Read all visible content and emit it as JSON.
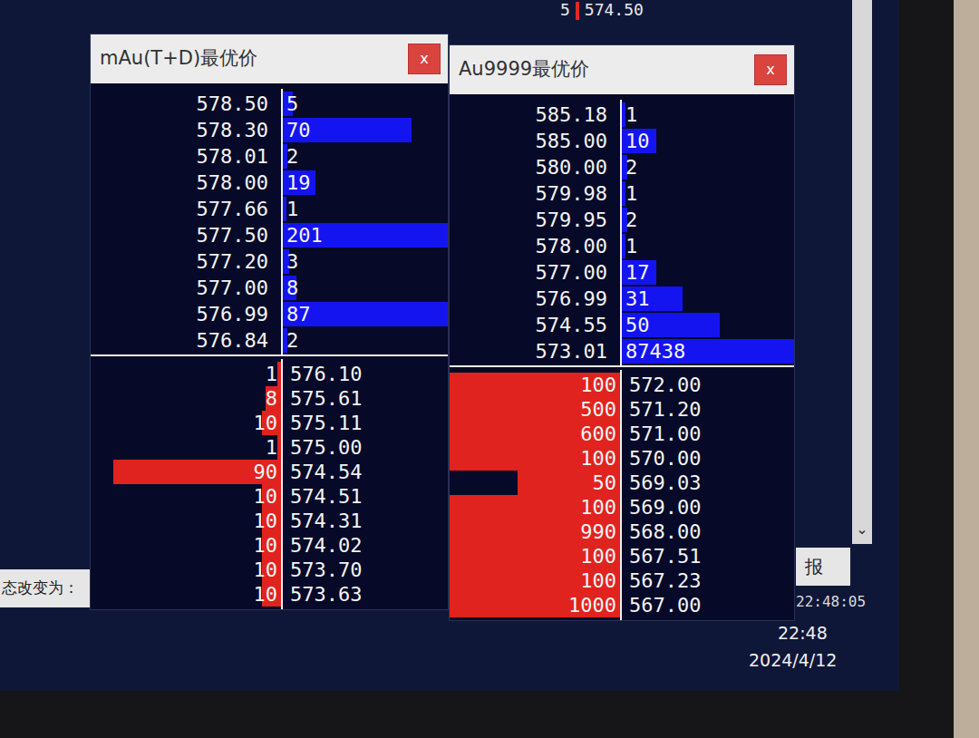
{
  "top_fragment": {
    "prefix": "5",
    "price": "574.50"
  },
  "windows": [
    {
      "title": "mAu(T+D)最优价",
      "close": "x",
      "asks": [
        {
          "price": "578.50",
          "qty": "5",
          "level": 0.06
        },
        {
          "price": "578.30",
          "qty": "70",
          "level": 0.78
        },
        {
          "price": "578.01",
          "qty": "2",
          "level": 0.03
        },
        {
          "price": "578.00",
          "qty": "19",
          "level": 0.2
        },
        {
          "price": "577.66",
          "qty": "1",
          "level": 0.02
        },
        {
          "price": "577.50",
          "qty": "201",
          "level": 1
        },
        {
          "price": "577.20",
          "qty": "3",
          "level": 0.04
        },
        {
          "price": "577.00",
          "qty": "8",
          "level": 0.08
        },
        {
          "price": "576.99",
          "qty": "87",
          "level": 1
        },
        {
          "price": "576.84",
          "qty": "2",
          "level": 0.03
        }
      ],
      "bids": [
        {
          "qty": "1",
          "price": "576.10",
          "level": 0.02
        },
        {
          "qty": "8",
          "price": "575.61",
          "level": 0.08
        },
        {
          "qty": "10",
          "price": "575.11",
          "level": 0.1
        },
        {
          "qty": "1",
          "price": "575.00",
          "level": 0.02
        },
        {
          "qty": "90",
          "price": "574.54",
          "level": 0.88
        },
        {
          "qty": "10",
          "price": "574.51",
          "level": 0.1
        },
        {
          "qty": "10",
          "price": "574.31",
          "level": 0.1
        },
        {
          "qty": "10",
          "price": "574.02",
          "level": 0.1
        },
        {
          "qty": "10",
          "price": "573.70",
          "level": 0.1
        },
        {
          "qty": "10",
          "price": "573.63",
          "level": 0.1
        }
      ]
    },
    {
      "title": "Au9999最优价",
      "close": "x",
      "asks": [
        {
          "price": "585.18",
          "qty": "1",
          "level": 0.02
        },
        {
          "price": "585.00",
          "qty": "10",
          "level": 0.2
        },
        {
          "price": "580.00",
          "qty": "2",
          "level": 0.03
        },
        {
          "price": "579.98",
          "qty": "1",
          "level": 0.02
        },
        {
          "price": "579.95",
          "qty": "2",
          "level": 0.03
        },
        {
          "price": "578.00",
          "qty": "1",
          "level": 0.02
        },
        {
          "price": "577.00",
          "qty": "17",
          "level": 0.2
        },
        {
          "price": "576.99",
          "qty": "31",
          "level": 0.35
        },
        {
          "price": "574.55",
          "qty": "50",
          "level": 0.57
        },
        {
          "price": "573.01",
          "qty": "87438",
          "level": 1
        }
      ],
      "bids": [
        {
          "qty": "100",
          "price": "572.00",
          "level": 1
        },
        {
          "qty": "500",
          "price": "571.20",
          "level": 1
        },
        {
          "qty": "600",
          "price": "571.00",
          "level": 1
        },
        {
          "qty": "100",
          "price": "570.00",
          "level": 1
        },
        {
          "qty": "50",
          "price": "569.03",
          "level": 0.6
        },
        {
          "qty": "100",
          "price": "569.00",
          "level": 1
        },
        {
          "qty": "990",
          "price": "568.00",
          "level": 1
        },
        {
          "qty": "100",
          "price": "567.51",
          "level": 1
        },
        {
          "qty": "100",
          "price": "567.23",
          "level": 1
        },
        {
          "qty": "1000",
          "price": "567.00",
          "level": 1
        }
      ]
    }
  ],
  "status_label": "态改变为：",
  "side_panel": {
    "label": "报",
    "time": "22:48:05"
  },
  "scroll_arrow": "⌄",
  "taskbar": {
    "time": "22:48",
    "date": "2024/4/12"
  }
}
